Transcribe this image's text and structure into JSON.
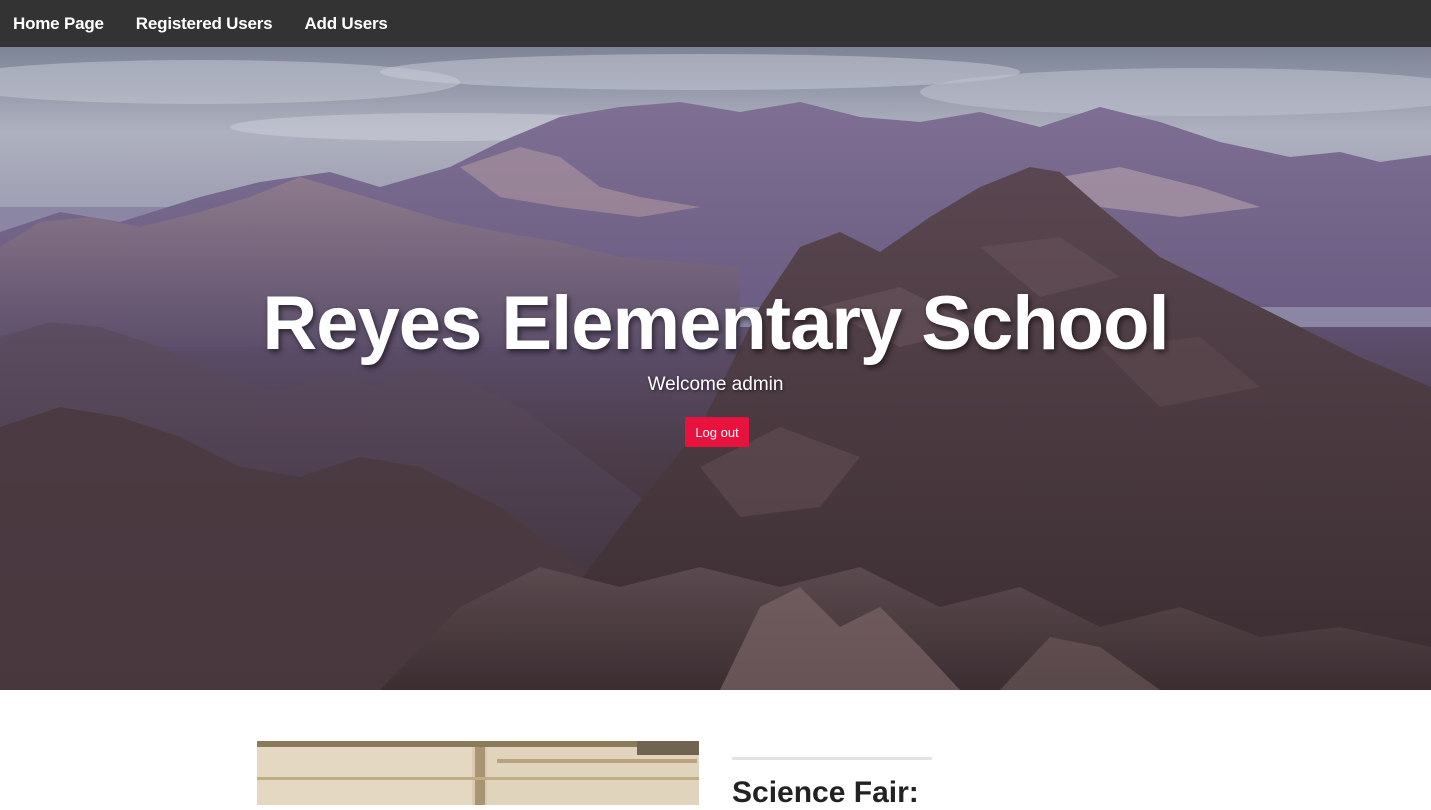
{
  "nav": {
    "items": [
      {
        "label": "Home Page"
      },
      {
        "label": "Registered Users"
      },
      {
        "label": "Add Users"
      }
    ]
  },
  "hero": {
    "title": "Reyes Elementary School",
    "welcome": "Welcome admin",
    "logout_label": "Log out"
  },
  "content": {
    "heading": "Science Fair:"
  },
  "colors": {
    "navbar_bg": "#333333",
    "accent_button": "#e8123e",
    "text_light": "#ffffff",
    "heading_text": "#222222"
  }
}
